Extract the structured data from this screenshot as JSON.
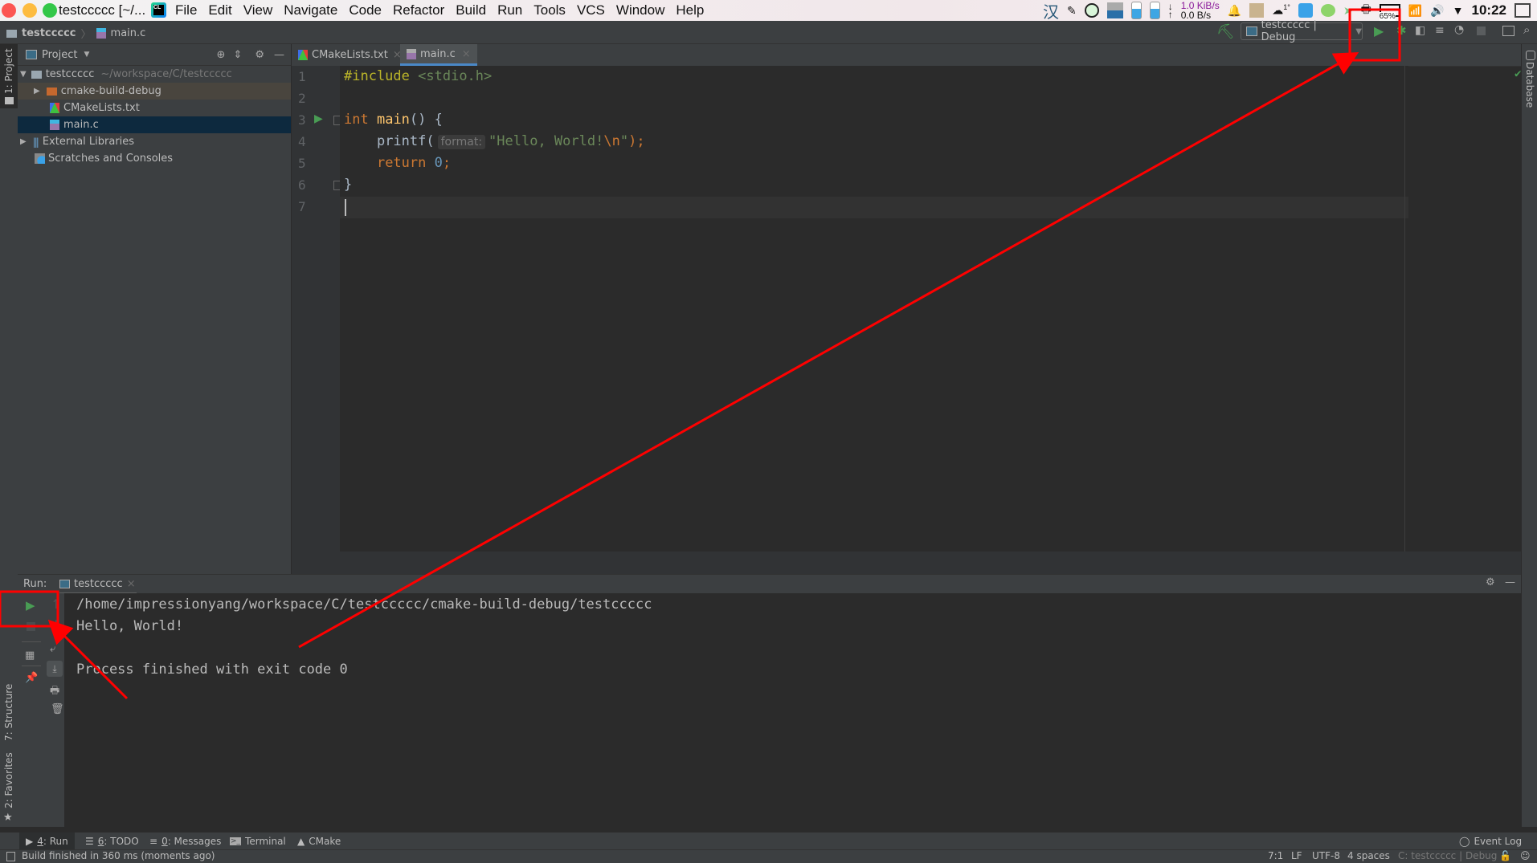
{
  "window": {
    "title": "testccccc [~/...",
    "menu": [
      "File",
      "Edit",
      "View",
      "Navigate",
      "Code",
      "Refactor",
      "Build",
      "Run",
      "Tools",
      "VCS",
      "Window",
      "Help"
    ]
  },
  "tray": {
    "ime": "汉",
    "net_down": "1.0 KiB/s",
    "net_up": "0.0 B/s",
    "weather": "1°",
    "battery": "65%",
    "clock": "10:22"
  },
  "navbar": {
    "breadcrumb": [
      "testccccc",
      "main.c"
    ],
    "run_config": "testccccc | Debug"
  },
  "project_panel": {
    "title": "Project",
    "side_label": "1: Project",
    "tree": [
      {
        "label": "testccccc",
        "hint": "~/workspace/C/testccccc",
        "type": "folder",
        "depth": 0,
        "expanded": true
      },
      {
        "label": "cmake-build-debug",
        "type": "folder-excluded",
        "depth": 1,
        "expanded": false
      },
      {
        "label": "CMakeLists.txt",
        "type": "cmake",
        "depth": 1
      },
      {
        "label": "main.c",
        "type": "c-file",
        "depth": 1,
        "selected": true
      },
      {
        "label": "External Libraries",
        "type": "libraries",
        "depth": 0,
        "expanded": false
      },
      {
        "label": "Scratches and Consoles",
        "type": "scratches",
        "depth": 0
      }
    ]
  },
  "editor": {
    "tabs": [
      {
        "label": "CMakeLists.txt",
        "active": false
      },
      {
        "label": "main.c",
        "active": true
      }
    ],
    "line_numbers": [
      "1",
      "2",
      "3",
      "4",
      "5",
      "6",
      "7"
    ],
    "lines": {
      "l1_directive": "#include",
      "l1_header": "<stdio.h>",
      "l3_type": "int",
      "l3_func": "main",
      "l3_rest": "() {",
      "l4_func": "printf(",
      "l4_hint": "format:",
      "l4_string": "\"Hello, World!",
      "l4_escape": "\\n",
      "l4_string_end": "\"",
      "l4_end": ");",
      "l5_keyword": "return",
      "l5_number": "0",
      "l5_end": ";",
      "l6": "}"
    },
    "cursor_position": "7:1"
  },
  "right_stripe": {
    "label": "Database"
  },
  "left_stripe_bottom": [
    "7: Structure",
    "2: Favorites"
  ],
  "run_panel": {
    "label": "Run:",
    "tab": "testccccc",
    "output": [
      "/home/impressionyang/workspace/C/testccccc/cmake-build-debug/testccccc",
      "Hello, World!",
      "",
      "Process finished with exit code 0"
    ]
  },
  "tool_tabs": [
    {
      "num": "4",
      "label": ": Run",
      "icon": "run"
    },
    {
      "num": "6",
      "label": ": TODO",
      "icon": "todo"
    },
    {
      "num": "0",
      "label": ": Messages",
      "icon": "messages"
    },
    {
      "num": "",
      "label": "Terminal",
      "icon": "terminal"
    },
    {
      "num": "",
      "label": "CMake",
      "icon": "cmake"
    }
  ],
  "event_log": "Event Log",
  "status": {
    "message": "Build finished in 360 ms (moments ago)",
    "position": "7:1",
    "line_sep": "LF",
    "encoding": "UTF-8",
    "indent": "4 spaces",
    "context": "C: testccccc | Debug"
  },
  "colors": {
    "accent": "#4a88c7",
    "run_green": "#499c54",
    "annotation_red": "#ff0000"
  }
}
